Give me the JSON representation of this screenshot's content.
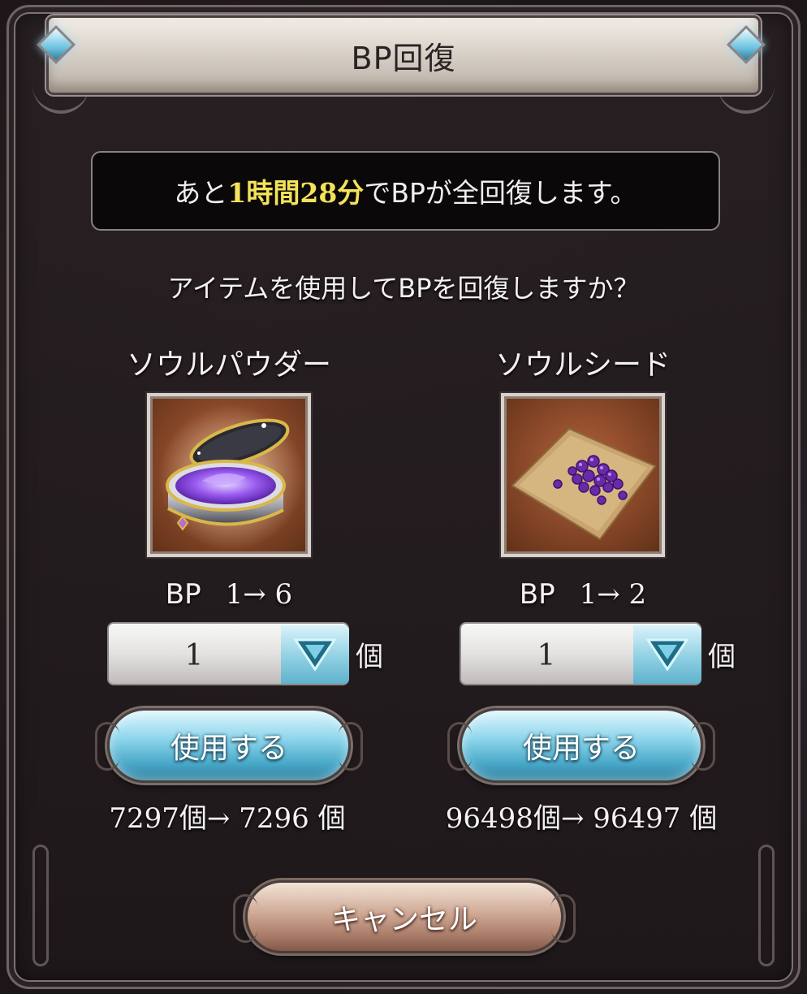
{
  "dialog": {
    "title": "BP回復",
    "info": {
      "prefix": "あと",
      "highlight": "1時間28分",
      "suffix": "でBPが全回復します。"
    },
    "question": "アイテムを使用してBPを回復しますか？"
  },
  "items": [
    {
      "name": "ソウルパウダー",
      "icon": "soul-powder-icon",
      "bp_label": "BP",
      "bp_change": "1→ 6",
      "quantity": "1",
      "unit": "個",
      "use_label": "使用する",
      "stock": "7297個→ 7296 個"
    },
    {
      "name": "ソウルシード",
      "icon": "soul-seed-icon",
      "bp_label": "BP",
      "bp_change": "1→ 2",
      "quantity": "1",
      "unit": "個",
      "use_label": "使用する",
      "stock": "96498個→ 96497 個"
    }
  ],
  "cancel_label": "キャンセル",
  "colors": {
    "highlight": "#f3e25a",
    "use_button": "#8ed6ec",
    "cancel_button": "#cfa995"
  }
}
